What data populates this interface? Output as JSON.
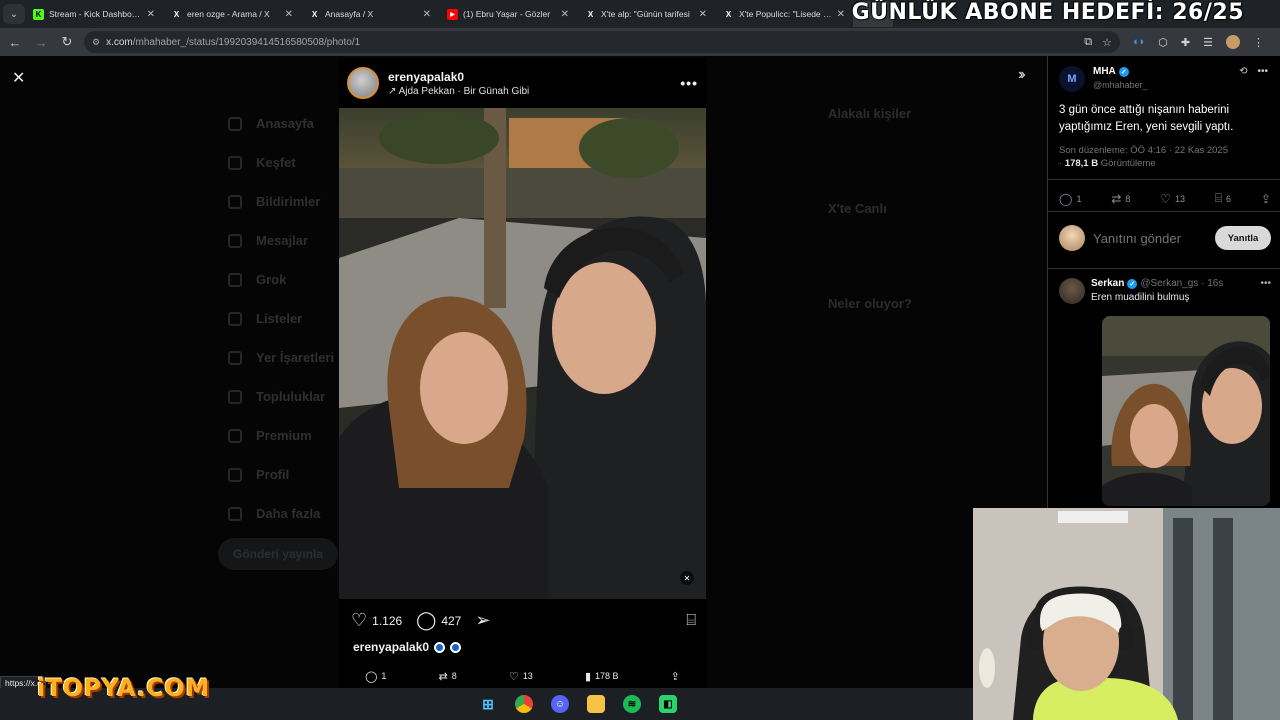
{
  "tabs": [
    {
      "title": "Stream - Kick Dashboard",
      "favicon": "kick-icon",
      "color": "#53fc18",
      "glyph": "K"
    },
    {
      "title": "eren ozge - Arama / X",
      "favicon": "x-icon",
      "color": "#000000",
      "glyph": "X"
    },
    {
      "title": "Anasayfa / X",
      "favicon": "x-icon",
      "color": "#000000",
      "glyph": "X"
    },
    {
      "title": "(1) Ebru Yaşar - Gözler",
      "favicon": "youtube-icon",
      "color": "#ff0000",
      "glyph": "▶"
    },
    {
      "title": "X'te alp: \"Günün tarifesi",
      "favicon": "x-icon",
      "color": "#000000",
      "glyph": "X"
    },
    {
      "title": "X'te Populicc: \"Lisede çek",
      "favicon": "x-icon",
      "color": "#000000",
      "glyph": "X"
    }
  ],
  "overlay": {
    "goal_text": "GÜNLÜK ABONE HEDEFİ: 26/25"
  },
  "address": {
    "url_host": "x.com",
    "url_path": "/mhahaber_/status/1992039414516580508/photo/1"
  },
  "background_nav": [
    "Anasayfa",
    "Keşfet",
    "Bildirimler",
    "Mesajlar",
    "Grok",
    "Listeler",
    "Yer İşaretleri",
    "Topluluklar",
    "Premium",
    "Profil",
    "Daha fazla"
  ],
  "background_post_button": "Gönderi yayınla",
  "background_right": [
    "Alakalı kişiler",
    "X'te Canlı",
    "Neler oluyor?"
  ],
  "media": {
    "ig_user": "erenyapalak0",
    "ig_music": "↗ Ajda Pekkan · Bir Günah Gibi",
    "likes": "1.126",
    "comments": "427",
    "caption_user": "erenyapalak0"
  },
  "media_bar": {
    "replies": "1",
    "reposts": "8",
    "likes": "13",
    "views": "178 B"
  },
  "post": {
    "author_name": "MHA",
    "author_handle": "@mhahaber_",
    "text": "3 gün önce attığı nişanın haberini yaptığımız Eren, yeni sevgili yaptı.",
    "edited": "Son düzenleme: ÖÖ 4:16 · 22 Kas 2025",
    "views_count": "178,1 B",
    "views_label": "Görüntüleme",
    "stats": {
      "replies": "1",
      "reposts": "8",
      "likes": "13",
      "bookmarks": "6"
    }
  },
  "reply_box": {
    "placeholder": "Yanıtını gönder",
    "button": "Yanıtla"
  },
  "comment": {
    "name": "Serkan",
    "handle": "@Serkan_gs · 16s",
    "text": "Eren muadilini bulmuş"
  },
  "status_url": "https://x.c",
  "watermark": "iTOPYA.COM",
  "colors": {
    "accent": "#1d9bf0",
    "background": "#000000",
    "text": "#e7e9ea",
    "muted": "#71767b"
  }
}
